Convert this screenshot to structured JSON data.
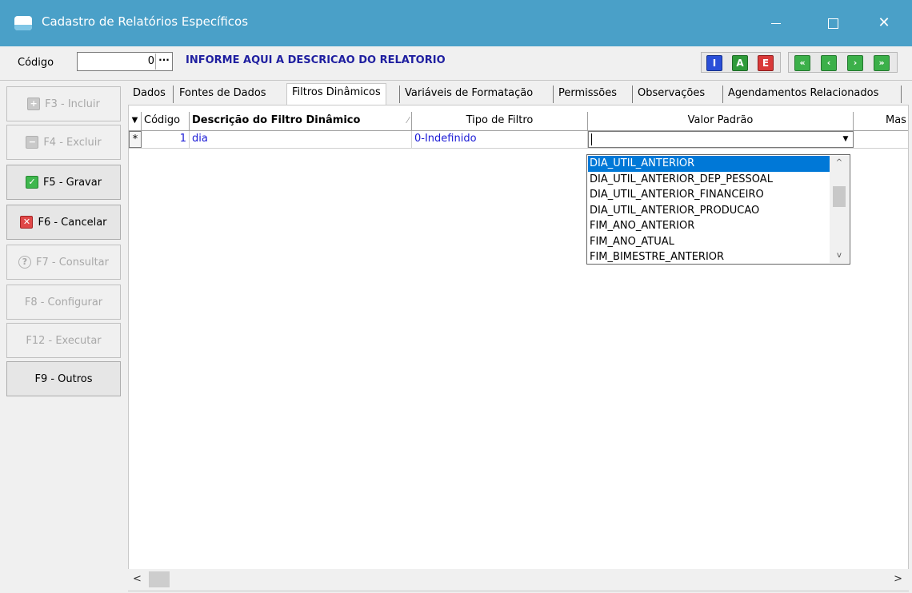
{
  "window": {
    "title": "Cadastro de Relatórios Específicos",
    "minimize_glyph": "",
    "maximize_glyph": "",
    "close_glyph": "✕"
  },
  "header": {
    "codigo_label": "Código",
    "codigo_value": "0",
    "codigo_lookup": "···",
    "description": "INFORME AQUI A DESCRICAO DO RELATORIO",
    "mode_buttons": [
      {
        "label": "I",
        "color": "#2a4fd8"
      },
      {
        "label": "A",
        "color": "#2f9a3a"
      },
      {
        "label": "E",
        "color": "#d93a3a"
      }
    ],
    "nav_buttons": [
      {
        "glyph": "«",
        "icon": "first-record-icon"
      },
      {
        "glyph": "‹",
        "icon": "previous-record-icon"
      },
      {
        "glyph": "›",
        "icon": "next-record-icon"
      },
      {
        "glyph": "»",
        "icon": "last-record-icon"
      }
    ]
  },
  "side_buttons": [
    {
      "label": "F3 - Incluir",
      "enabled": false,
      "icon": "plus-icon"
    },
    {
      "label": "F4 - Excluir",
      "enabled": false,
      "icon": "minus-icon"
    },
    {
      "label": "F5 - Gravar",
      "enabled": true,
      "icon": "check-icon"
    },
    {
      "label": "F6 - Cancelar",
      "enabled": true,
      "icon": "x-icon"
    },
    {
      "label": "F7 - Consultar",
      "enabled": false,
      "icon": "question-icon"
    },
    {
      "label": "F8 - Configurar",
      "enabled": false,
      "icon": ""
    },
    {
      "label": "F12 - Executar",
      "enabled": false,
      "icon": ""
    },
    {
      "label": "F9 - Outros",
      "enabled": true,
      "icon": ""
    }
  ],
  "tabs": [
    {
      "label": "Dados"
    },
    {
      "label": "Fontes de Dados"
    },
    {
      "label": "Filtros Dinâmicos",
      "active": true
    },
    {
      "label": "Variáveis de Formatação"
    },
    {
      "label": "Permissões"
    },
    {
      "label": "Observações"
    },
    {
      "label": "Agendamentos Relacionados"
    }
  ],
  "grid": {
    "columns": {
      "indicator": "▼",
      "codigo": "Código",
      "descricao": "Descrição do Filtro Dinâmico",
      "sort_glyph": "⁄",
      "tipo": "Tipo de Filtro",
      "valor": "Valor Padrão",
      "mascara": "Mas"
    },
    "row": {
      "indicator": "*",
      "codigo": "1",
      "descricao": "dia",
      "tipo": "0-Indefinido",
      "valor": ""
    }
  },
  "dropdown": {
    "options": [
      "DIA_UTIL_ANTERIOR",
      "DIA_UTIL_ANTERIOR_DEP_PESSOAL",
      "DIA_UTIL_ANTERIOR_FINANCEIRO",
      "DIA_UTIL_ANTERIOR_PRODUCAO",
      "FIM_ANO_ANTERIOR",
      "FIM_ANO_ATUAL",
      "FIM_BIMESTRE_ANTERIOR"
    ],
    "selected_index": 0
  },
  "scroll": {
    "left_glyph": "<",
    "right_glyph": ">",
    "up_glyph": "^",
    "down_glyph": "v"
  }
}
